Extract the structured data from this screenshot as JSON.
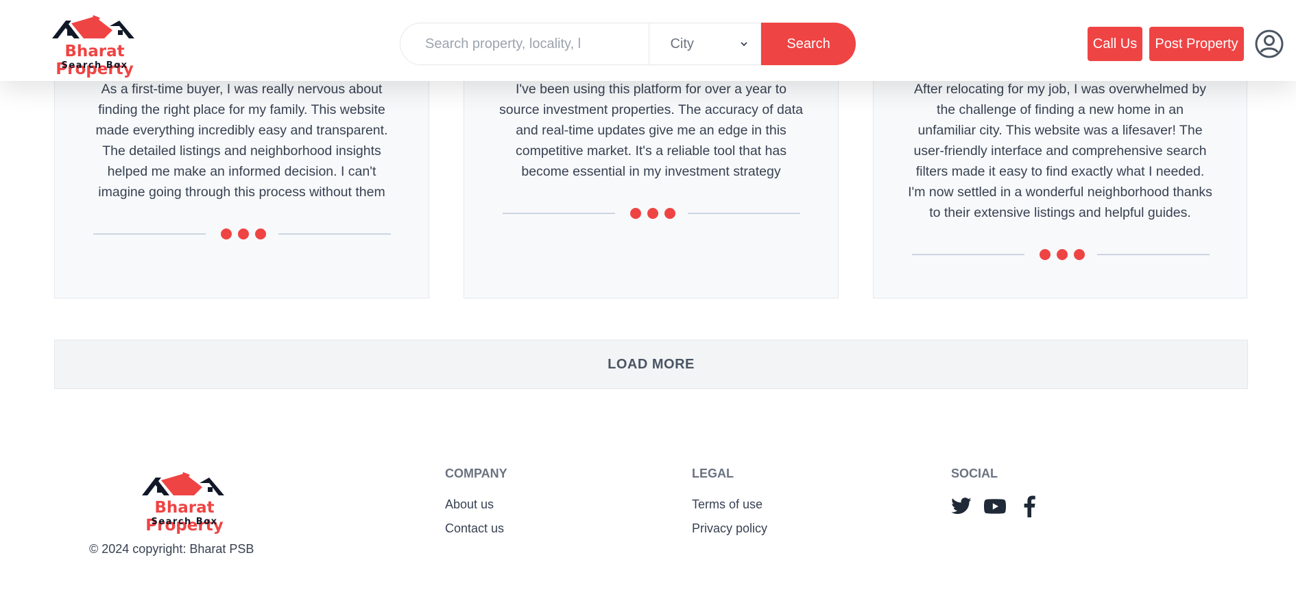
{
  "brand": {
    "name": "Bharat Property",
    "tagline": "Search Box",
    "colors": {
      "accent": "#ef4444",
      "text": "#374151",
      "muted": "#6b7280"
    }
  },
  "header": {
    "search_placeholder": "Search property, locality, l",
    "city_value": "City",
    "search_label": "Search",
    "call_label": "Call Us",
    "post_label": "Post Property",
    "user_icon": "user-circle-icon"
  },
  "testimonials": [
    {
      "text": "As a first-time buyer, I was really nervous about finding the right place for my family. This website made everything incredibly easy and transparent. The detailed listings and neighborhood insights helped me make an informed decision. I can't imagine going through this process without them"
    },
    {
      "text": "I've been using this platform for over a year to source investment properties. The accuracy of data and real-time updates give me an edge in this competitive market. It's a reliable tool that has become essential in my investment strategy"
    },
    {
      "text": "After relocating for my job, I was overwhelmed by the challenge of finding a new home in an unfamiliar city. This website was a lifesaver! The user-friendly interface and comprehensive search filters made it easy to find exactly what I needed. I'm now settled in a wonderful neighborhood thanks to their extensive listings and helpful guides."
    }
  ],
  "load_more_label": "LOAD MORE",
  "footer": {
    "copyright": "© 2024 copyright: Bharat PSB",
    "company": {
      "heading": "COMPANY",
      "links": [
        "About us",
        "Contact us"
      ]
    },
    "legal": {
      "heading": "LEGAL",
      "links": [
        "Terms of use",
        "Privacy policy"
      ]
    },
    "social": {
      "heading": "SOCIAL",
      "icons": [
        "twitter-icon",
        "youtube-icon",
        "facebook-icon"
      ]
    }
  }
}
